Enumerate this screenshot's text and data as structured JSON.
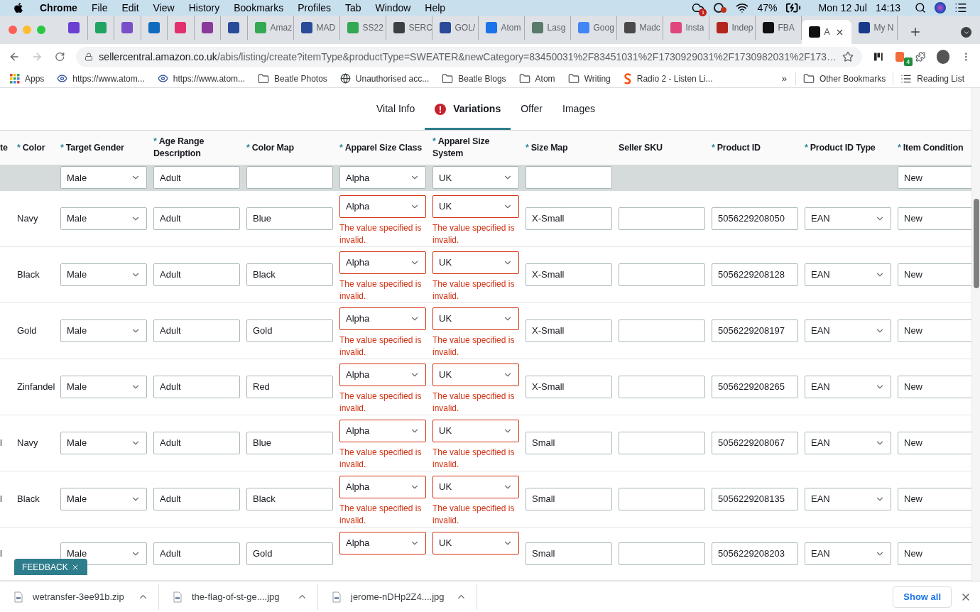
{
  "menu_bar": {
    "app": "Chrome",
    "items": [
      "File",
      "Edit",
      "View",
      "History",
      "Bookmarks",
      "Profiles",
      "Tab",
      "Window",
      "Help"
    ],
    "cloud_badge": "1",
    "battery": "47%",
    "date": "Mon 12 Jul",
    "time": "14:13"
  },
  "tabs": [
    {
      "color": "#6b3fd4",
      "selected": false
    },
    {
      "color": "#1fa463",
      "selected": false
    },
    {
      "color": "#7a4fc9",
      "selected": false
    },
    {
      "color": "#0f6cbd",
      "selected": false
    },
    {
      "color": "#e1306c",
      "selected": false
    },
    {
      "color": "#8a3a9a",
      "selected": false
    },
    {
      "color": "#2a4a9a",
      "selected": false
    },
    {
      "title": "Amaz",
      "color": "#34a853",
      "selected": false
    },
    {
      "title": "MAD",
      "color": "#2a4a9a",
      "selected": false
    },
    {
      "title": "SS22",
      "color": "#34a853",
      "selected": false
    },
    {
      "title": "SERC",
      "color": "#3c4043",
      "selected": false
    },
    {
      "title": "GOL/",
      "color": "#2a4a9a",
      "selected": false
    },
    {
      "title": "Atom",
      "color": "#1a73e8",
      "selected": false
    },
    {
      "title": "Lasg",
      "color": "#5a7a6a",
      "selected": false
    },
    {
      "title": "Goog",
      "color": "#4285f4",
      "selected": false
    },
    {
      "title": "Madc",
      "color": "#4a4a4a",
      "selected": false
    },
    {
      "title": "Insta",
      "color": "#e0457b",
      "selected": false
    },
    {
      "title": "Indep",
      "color": "#b3261e",
      "selected": false
    },
    {
      "title": "FBA",
      "color": "#111111",
      "selected": false
    },
    {
      "title": "A",
      "color": "#111111",
      "selected": true
    },
    {
      "title": "My N",
      "color": "#1a3a8a",
      "selected": false
    }
  ],
  "address": {
    "host": "sellercentral.amazon.co.uk",
    "path": "/abis/listing/create?itemType&productType=SWEATER&newCategory=83450031%2F83451031%2F1730929031%2F1730982031%2F173…",
    "extension_badge": "4"
  },
  "bookmarks": [
    {
      "kind": "apps",
      "label": "Apps"
    },
    {
      "kind": "site",
      "label": "https://www.atom..."
    },
    {
      "kind": "site",
      "label": "https://www.atom..."
    },
    {
      "kind": "folder",
      "label": "Beatle Photos"
    },
    {
      "kind": "globe",
      "label": "Unauthorised acc..."
    },
    {
      "kind": "folder",
      "label": "Beatle Blogs"
    },
    {
      "kind": "folder",
      "label": "Atom"
    },
    {
      "kind": "folder",
      "label": "Writing"
    },
    {
      "kind": "radio",
      "label": "Radio 2 - Listen Li..."
    }
  ],
  "bookmarks_more": "»",
  "bookmarks_right": [
    {
      "kind": "folder",
      "label": "Other Bookmarks"
    },
    {
      "kind": "list",
      "label": "Reading List"
    }
  ],
  "page_tabs": [
    {
      "label": "Vital Info",
      "selected": false,
      "error": false
    },
    {
      "label": "Variations",
      "selected": true,
      "error": true
    },
    {
      "label": "Offer",
      "selected": false,
      "error": false
    },
    {
      "label": "Images",
      "selected": false,
      "error": false
    }
  ],
  "table": {
    "columns": [
      {
        "label": "te"
      },
      {
        "marker": "*",
        "label": "Color"
      },
      {
        "marker": "*",
        "label": "Target Gender"
      },
      {
        "marker": "*",
        "label": "Age Range Description"
      },
      {
        "marker": "*",
        "label": "Color Map"
      },
      {
        "marker": "*",
        "label": "Apparel Size Class"
      },
      {
        "marker": "*",
        "label": "Apparel Size System"
      },
      {
        "marker": "*",
        "label": "Size Map"
      },
      {
        "label": "Seller SKU"
      },
      {
        "marker": "*",
        "label": "Product ID"
      },
      {
        "marker": "*",
        "label": "Product ID Type"
      },
      {
        "marker": "*",
        "label": "Item Condition"
      }
    ],
    "default_row": [
      {
        "kind": "blank"
      },
      {
        "kind": "blank"
      },
      {
        "kind": "select",
        "value": "Male",
        "invalid": false
      },
      {
        "kind": "input",
        "value": "Adult"
      },
      {
        "kind": "input"
      },
      {
        "kind": "select",
        "value": "Alpha",
        "invalid": false
      },
      {
        "kind": "select",
        "value": "UK",
        "invalid": false
      },
      {
        "kind": "input"
      },
      {
        "kind": "blank"
      },
      {
        "kind": "blank"
      },
      {
        "kind": "blank"
      },
      {
        "kind": "input",
        "value": "New"
      }
    ],
    "rows": [
      [
        {
          "kind": "blank"
        },
        {
          "kind": "text",
          "value": "Navy"
        },
        {
          "kind": "select",
          "value": "Male",
          "invalid": false
        },
        {
          "kind": "input",
          "value": "Adult"
        },
        {
          "kind": "input",
          "value": "Blue"
        },
        {
          "kind": "select",
          "value": "Alpha",
          "invalid": true,
          "error": "The value specified is invalid."
        },
        {
          "kind": "select",
          "value": "UK",
          "invalid": true,
          "error": "The value specified is invalid."
        },
        {
          "kind": "input",
          "value": "X-Small"
        },
        {
          "kind": "input"
        },
        {
          "kind": "input",
          "value": "5056229208050"
        },
        {
          "kind": "select",
          "value": "EAN",
          "invalid": false
        },
        {
          "kind": "input",
          "value": "New"
        }
      ],
      [
        {
          "kind": "blank"
        },
        {
          "kind": "text",
          "value": "Black"
        },
        {
          "kind": "select",
          "value": "Male",
          "invalid": false
        },
        {
          "kind": "input",
          "value": "Adult"
        },
        {
          "kind": "input",
          "value": "Black"
        },
        {
          "kind": "select",
          "value": "Alpha",
          "invalid": true,
          "error": "The value specified is invalid."
        },
        {
          "kind": "select",
          "value": "UK",
          "invalid": true,
          "error": "The value specified is invalid."
        },
        {
          "kind": "input",
          "value": "X-Small"
        },
        {
          "kind": "input"
        },
        {
          "kind": "input",
          "value": "5056229208128"
        },
        {
          "kind": "select",
          "value": "EAN",
          "invalid": false
        },
        {
          "kind": "input",
          "value": "New"
        }
      ],
      [
        {
          "kind": "blank"
        },
        {
          "kind": "text",
          "value": "Gold"
        },
        {
          "kind": "select",
          "value": "Male",
          "invalid": false
        },
        {
          "kind": "input",
          "value": "Adult"
        },
        {
          "kind": "input",
          "value": "Gold"
        },
        {
          "kind": "select",
          "value": "Alpha",
          "invalid": true,
          "error": "The value specified is invalid."
        },
        {
          "kind": "select",
          "value": "UK",
          "invalid": true,
          "error": "The value specified is invalid."
        },
        {
          "kind": "input",
          "value": "X-Small"
        },
        {
          "kind": "input"
        },
        {
          "kind": "input",
          "value": "5056229208197"
        },
        {
          "kind": "select",
          "value": "EAN",
          "invalid": false
        },
        {
          "kind": "input",
          "value": "New"
        }
      ],
      [
        {
          "kind": "blank"
        },
        {
          "kind": "text",
          "value": "Zinfandel"
        },
        {
          "kind": "select",
          "value": "Male",
          "invalid": false
        },
        {
          "kind": "input",
          "value": "Adult"
        },
        {
          "kind": "input",
          "value": "Red"
        },
        {
          "kind": "select",
          "value": "Alpha",
          "invalid": true,
          "error": "The value specified is invalid."
        },
        {
          "kind": "select",
          "value": "UK",
          "invalid": true,
          "error": "The value specified is invalid."
        },
        {
          "kind": "input",
          "value": "X-Small"
        },
        {
          "kind": "input"
        },
        {
          "kind": "input",
          "value": "5056229208265"
        },
        {
          "kind": "select",
          "value": "EAN",
          "invalid": false
        },
        {
          "kind": "input",
          "value": "New"
        }
      ],
      [
        {
          "kind": "text",
          "value": "l"
        },
        {
          "kind": "text",
          "value": "Navy"
        },
        {
          "kind": "select",
          "value": "Male",
          "invalid": false
        },
        {
          "kind": "input",
          "value": "Adult"
        },
        {
          "kind": "input",
          "value": "Blue"
        },
        {
          "kind": "select",
          "value": "Alpha",
          "invalid": true,
          "error": "The value specified is invalid."
        },
        {
          "kind": "select",
          "value": "UK",
          "invalid": true,
          "error": "The value specified is invalid."
        },
        {
          "kind": "input",
          "value": "Small"
        },
        {
          "kind": "input"
        },
        {
          "kind": "input",
          "value": "5056229208067"
        },
        {
          "kind": "select",
          "value": "EAN",
          "invalid": false
        },
        {
          "kind": "input",
          "value": "New"
        }
      ],
      [
        {
          "kind": "text",
          "value": "l"
        },
        {
          "kind": "text",
          "value": "Black"
        },
        {
          "kind": "select",
          "value": "Male",
          "invalid": false
        },
        {
          "kind": "input",
          "value": "Adult"
        },
        {
          "kind": "input",
          "value": "Black"
        },
        {
          "kind": "select",
          "value": "Alpha",
          "invalid": true,
          "error": "The value specified is invalid."
        },
        {
          "kind": "select",
          "value": "UK",
          "invalid": true,
          "error": "The value specified is invalid."
        },
        {
          "kind": "input",
          "value": "Small"
        },
        {
          "kind": "input"
        },
        {
          "kind": "input",
          "value": "5056229208135"
        },
        {
          "kind": "select",
          "value": "EAN",
          "invalid": false
        },
        {
          "kind": "input",
          "value": "New"
        }
      ],
      [
        {
          "kind": "text",
          "value": "l"
        },
        {
          "kind": "blank"
        },
        {
          "kind": "select",
          "value": "Male",
          "invalid": false
        },
        {
          "kind": "input",
          "value": "Adult"
        },
        {
          "kind": "input",
          "value": "Gold"
        },
        {
          "kind": "select",
          "value": "Alpha",
          "invalid": true
        },
        {
          "kind": "select",
          "value": "UK",
          "invalid": true
        },
        {
          "kind": "input",
          "value": "Small"
        },
        {
          "kind": "input"
        },
        {
          "kind": "input",
          "value": "5056229208203"
        },
        {
          "kind": "select",
          "value": "EAN",
          "invalid": false
        },
        {
          "kind": "input",
          "value": "New"
        }
      ]
    ]
  },
  "feedback": {
    "label": "FEEDBACK"
  },
  "downloads": [
    {
      "name": "wetransfer-3ee91b.zip"
    },
    {
      "name": "the-flag-of-st-ge....jpg"
    },
    {
      "name": "jerome-nDHp2Z4....jpg"
    }
  ],
  "show_all": "Show all"
}
